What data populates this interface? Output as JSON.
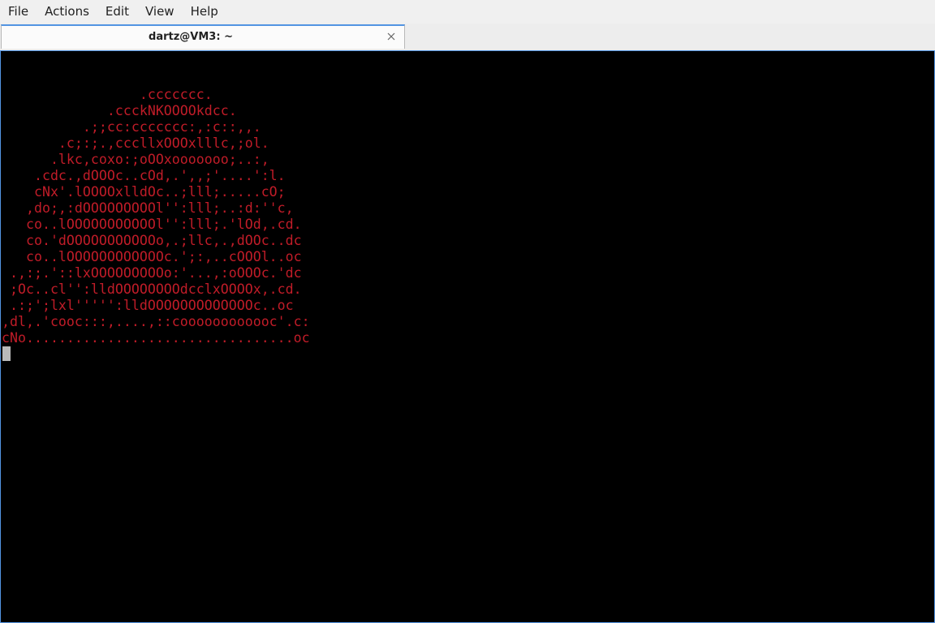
{
  "menubar": {
    "items": [
      "File",
      "Actions",
      "Edit",
      "View",
      "Help"
    ]
  },
  "tab": {
    "title": "dartz@VM3: ~",
    "close_icon": "close-icon"
  },
  "terminal": {
    "text_color": "#c01c28",
    "background": "#000000",
    "ascii_art": "                 .ccccccc.\n             .ccckNKOOOOkdcc.\n          .;;cc:ccccccc:,:c::,,.\n       .c;:;.,cccllxOOOxlllc,;ol.\n      .lkc,coxo:;oOOxooooooo;..:,\n    .cdc.,dOOOc..cOd,.',,;'....':l.\n    cNx'.lOOOOxlldOc..;lll;.....cO;\n   ,do;,:dOOOOOOOOOl'':lll;..:d:''c,\n   co..lOOOOOOOOOOOl'':lll;.'lOd,.cd.\n   co.'dOOOOOOOOOOOo,.;llc,.,dOOc..dc\n   co..lOOOOOOOOOOOOc.';:,..cOOOl..oc\n .,:;.'::lxOOOOOOOOOo:'...,:oOOOc.'dc\n ;Oc..cl'':lldOOOOOOOOdcclxOOOOx,.cd.\n .:;';lxl''''':lldOOOOOOOOOOOOOc..oc\n,dl,.'cooc:::,....,::coooooooooooc'.c:\ncNo.................................oc"
  }
}
